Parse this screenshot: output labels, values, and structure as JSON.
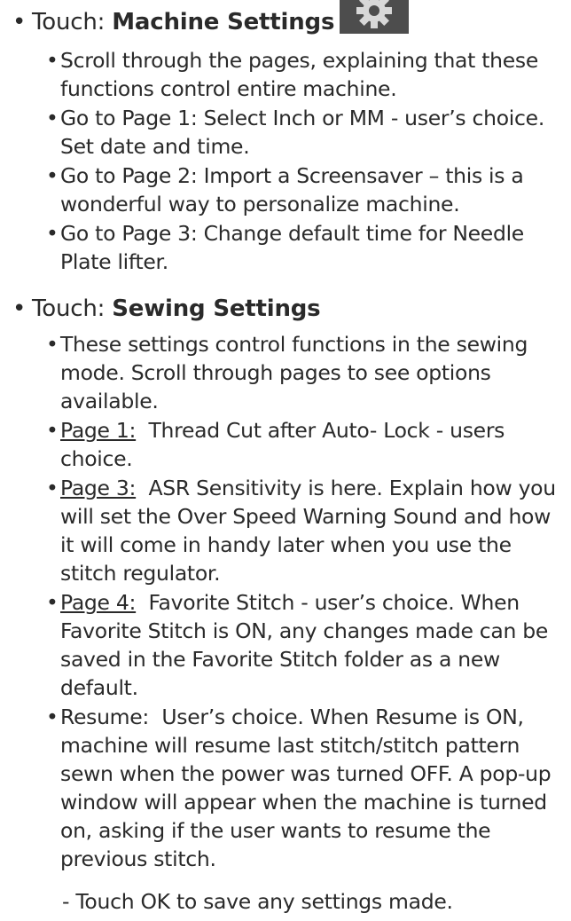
{
  "section1": {
    "prefix": "Touch: ",
    "title": "Machine Settings",
    "icon": "gear-icon",
    "items": [
      {
        "text": "Scroll through the pages, explaining that these functions control entire machine."
      },
      {
        "text": "Go to Page 1: Select Inch or MM - user’s choice. Set date and time."
      },
      {
        "text": "Go to Page 2: Import a Screensaver – this is a wonderful way to personalize machine."
      },
      {
        "text": "Go to Page 3: Change default time for Needle Plate lifter."
      }
    ]
  },
  "section2": {
    "prefix": "Touch: ",
    "title": "Sewing Settings",
    "items": [
      {
        "text": "These settings control functions in the sewing mode. Scroll through pages to see options available."
      },
      {
        "label": "Page 1:",
        "text": "  Thread Cut after Auto- Lock - users choice."
      },
      {
        "label": "Page 3:",
        "text": "  ASR Sensitivity is here. Explain how you will set the Over Speed Warning Sound and how it will come in handy later when you use the stitch regulator."
      },
      {
        "label": "Page 4:",
        "text": "  Favorite Stitch - user’s choice. When Favorite Stitch is ON, any changes made can be saved in the Favorite Stitch folder as a new default."
      },
      {
        "text": "Resume:  User’s choice. When Resume is ON, machine will resume last stitch/stitch pattern sewn when the power was turned OFF. A pop-up window will appear when the machine is turned on, asking if the user wants to resume the previous stitch."
      }
    ],
    "tail": "- Touch OK to save any settings made."
  }
}
